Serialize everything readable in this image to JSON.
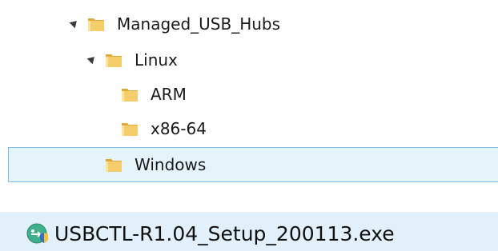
{
  "tree": {
    "items": [
      {
        "label": "Managed_USB_Hubs",
        "expanded": true,
        "icon": "folder-icon"
      },
      {
        "label": "Linux",
        "expanded": true,
        "icon": "folder-icon"
      },
      {
        "label": "ARM",
        "icon": "folder-icon"
      },
      {
        "label": "x86-64",
        "icon": "folder-icon"
      },
      {
        "label": "Windows",
        "icon": "folder-icon",
        "selected": true
      }
    ]
  },
  "file": {
    "name": "USBCTL-R1.04_Setup_200113.exe",
    "icon": "installer-icon"
  },
  "colors": {
    "selection_bg": "#e5f3fb",
    "selection_border": "#7bbde8",
    "file_strip_bg": "#e1f0fa",
    "folder": "#f2c35a"
  }
}
